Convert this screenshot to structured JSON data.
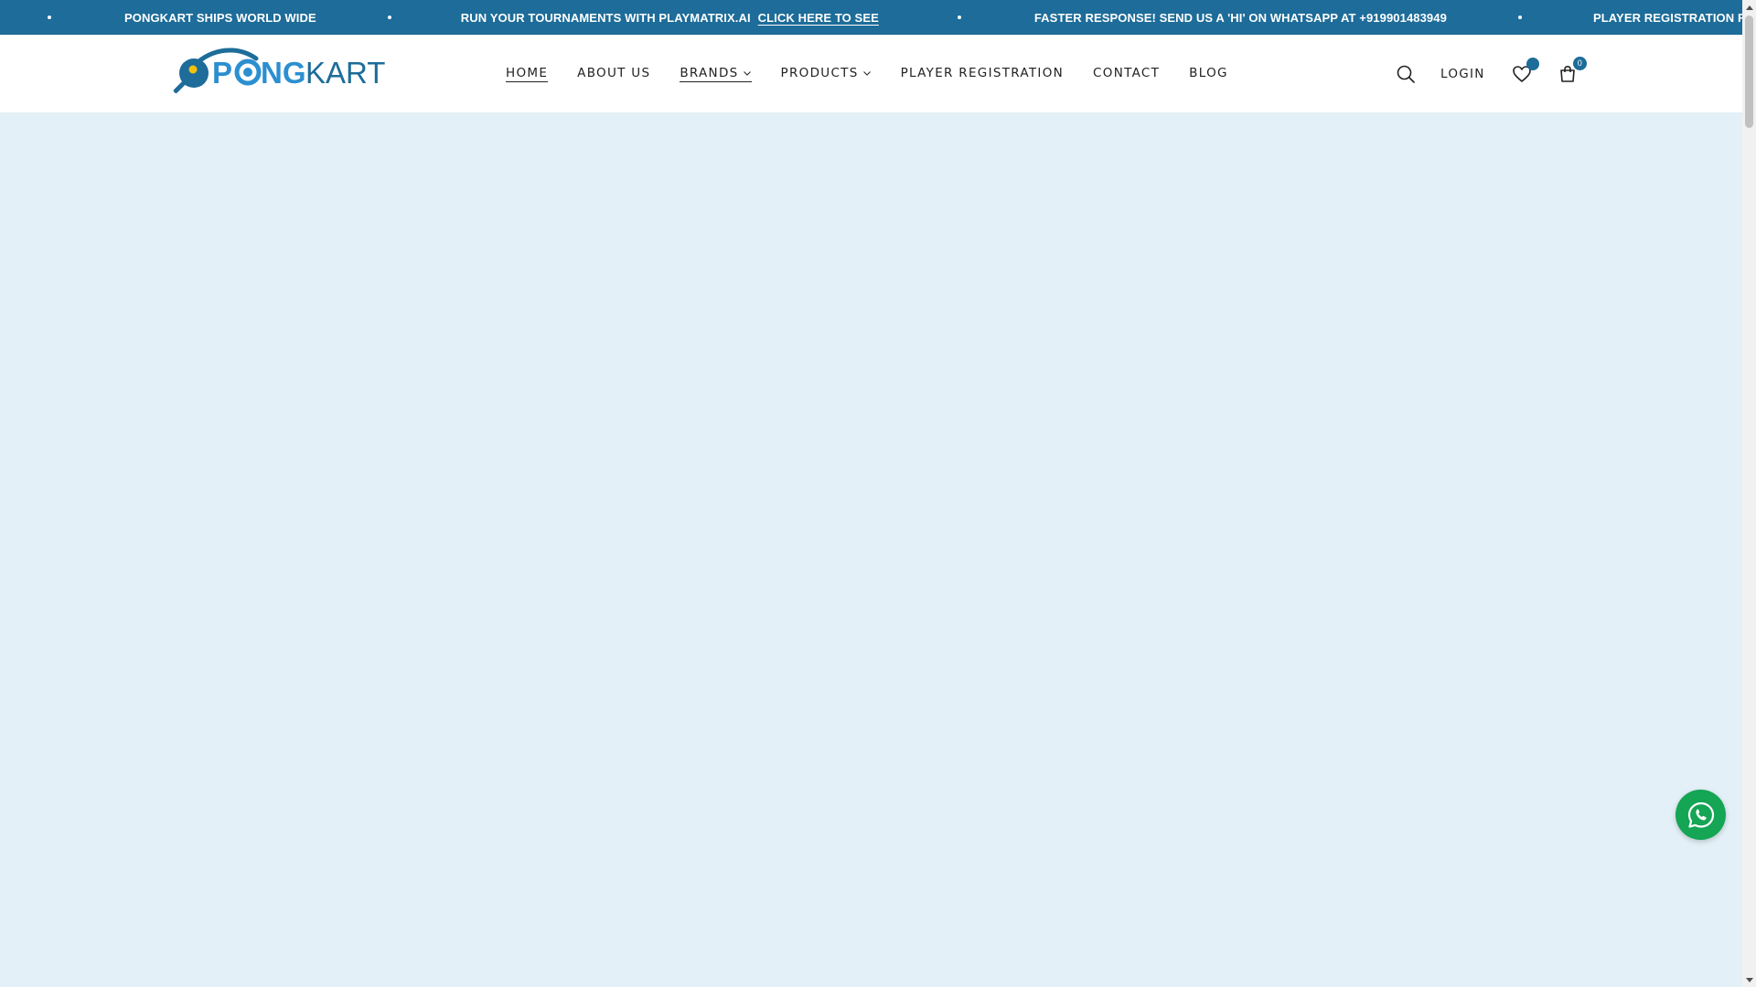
{
  "announcement": {
    "items": [
      {
        "text": "PONGKART SHIPS WORLD WIDE",
        "link": ""
      },
      {
        "text": "RUN YOUR TOURNAMENTS WITH PLAYMATRIX.AI",
        "link": "CLICK HERE TO SEE"
      },
      {
        "text": "FASTER RESPONSE! SEND US A 'HI' ON WHATSAPP AT +919901483949",
        "link": ""
      },
      {
        "text": "PLAYER REGISTRATION FOR DISCO",
        "link": ""
      }
    ]
  },
  "logo": {
    "part1": "P",
    "part2": "NG",
    "part3": "KART"
  },
  "nav": {
    "home": "HOME",
    "about": "ABOUT US",
    "brands": "BRANDS",
    "products": "PRODUCTS",
    "player_registration": "PLAYER REGISTRATION",
    "contact": "CONTACT",
    "blog": "BLOG"
  },
  "actions": {
    "login": "LOGIN",
    "cart_count": "0"
  },
  "colors": {
    "brand_blue": "#1d6c99",
    "logo_blue": "#2b8fd0",
    "page_bg": "#e3f0f7",
    "whatsapp_green": "#14a555"
  },
  "icons": [
    "search-icon",
    "heart-icon",
    "cart-icon",
    "chevron-down-icon",
    "whatsapp-icon"
  ]
}
